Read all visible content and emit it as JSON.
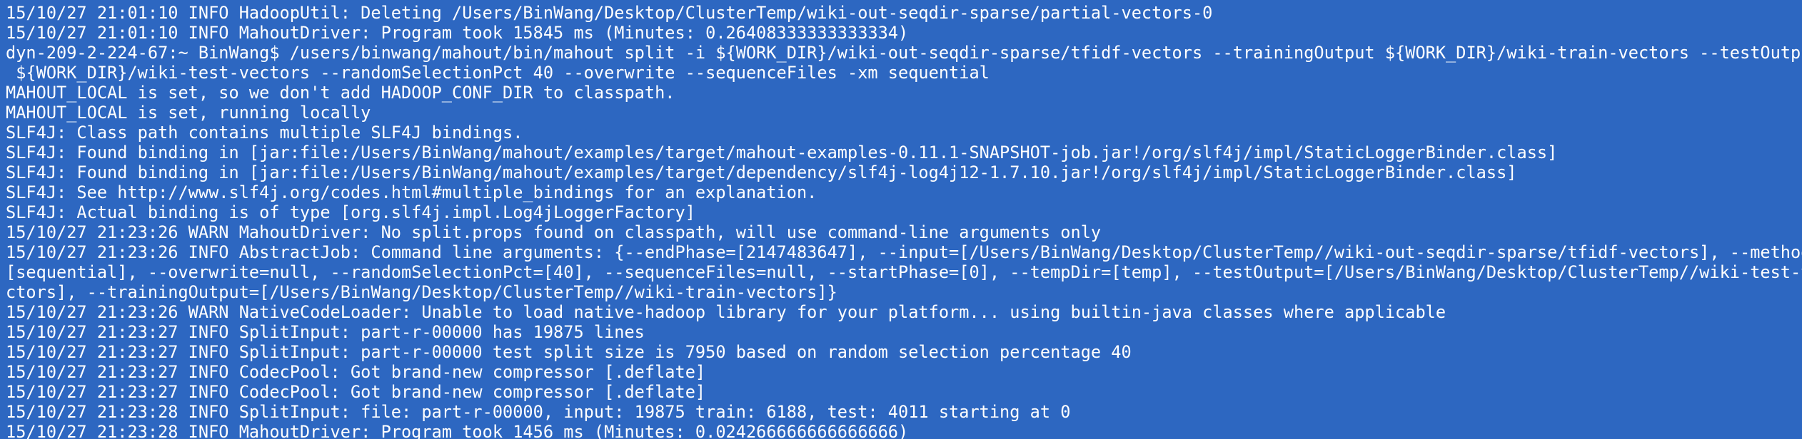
{
  "colors": {
    "background": "#2d67c1",
    "text": "#ffffff"
  },
  "terminal": {
    "lines": [
      "15/10/27 21:01:10 INFO HadoopUtil: Deleting /Users/BinWang/Desktop/ClusterTemp/wiki-out-seqdir-sparse/partial-vectors-0",
      "15/10/27 21:01:10 INFO MahoutDriver: Program took 15845 ms (Minutes: 0.26408333333333334)",
      "dyn-209-2-224-67:~ BinWang$ /users/binwang/mahout/bin/mahout split -i ${WORK_DIR}/wiki-out-seqdir-sparse/tfidf-vectors --trainingOutput ${WORK_DIR}/wiki-train-vectors --testOutput",
      " ${WORK_DIR}/wiki-test-vectors --randomSelectionPct 40 --overwrite --sequenceFiles -xm sequential",
      "MAHOUT_LOCAL is set, so we don't add HADOOP_CONF_DIR to classpath.",
      "MAHOUT_LOCAL is set, running locally",
      "SLF4J: Class path contains multiple SLF4J bindings.",
      "SLF4J: Found binding in [jar:file:/Users/BinWang/mahout/examples/target/mahout-examples-0.11.1-SNAPSHOT-job.jar!/org/slf4j/impl/StaticLoggerBinder.class]",
      "SLF4J: Found binding in [jar:file:/Users/BinWang/mahout/examples/target/dependency/slf4j-log4j12-1.7.10.jar!/org/slf4j/impl/StaticLoggerBinder.class]",
      "SLF4J: See http://www.slf4j.org/codes.html#multiple_bindings for an explanation.",
      "SLF4J: Actual binding is of type [org.slf4j.impl.Log4jLoggerFactory]",
      "15/10/27 21:23:26 WARN MahoutDriver: No split.props found on classpath, will use command-line arguments only",
      "15/10/27 21:23:26 INFO AbstractJob: Command line arguments: {--endPhase=[2147483647], --input=[/Users/BinWang/Desktop/ClusterTemp//wiki-out-seqdir-sparse/tfidf-vectors], --method=",
      "[sequential], --overwrite=null, --randomSelectionPct=[40], --sequenceFiles=null, --startPhase=[0], --tempDir=[temp], --testOutput=[/Users/BinWang/Desktop/ClusterTemp//wiki-test-ve",
      "ctors], --trainingOutput=[/Users/BinWang/Desktop/ClusterTemp//wiki-train-vectors]}",
      "15/10/27 21:23:26 WARN NativeCodeLoader: Unable to load native-hadoop library for your platform... using builtin-java classes where applicable",
      "15/10/27 21:23:27 INFO SplitInput: part-r-00000 has 19875 lines",
      "15/10/27 21:23:27 INFO SplitInput: part-r-00000 test split size is 7950 based on random selection percentage 40",
      "15/10/27 21:23:27 INFO CodecPool: Got brand-new compressor [.deflate]",
      "15/10/27 21:23:27 INFO CodecPool: Got brand-new compressor [.deflate]",
      "15/10/27 21:23:28 INFO SplitInput: file: part-r-00000, input: 19875 train: 6188, test: 4011 starting at 0",
      "15/10/27 21:23:28 INFO MahoutDriver: Program took 1456 ms (Minutes: 0.024266666666666666)"
    ]
  }
}
